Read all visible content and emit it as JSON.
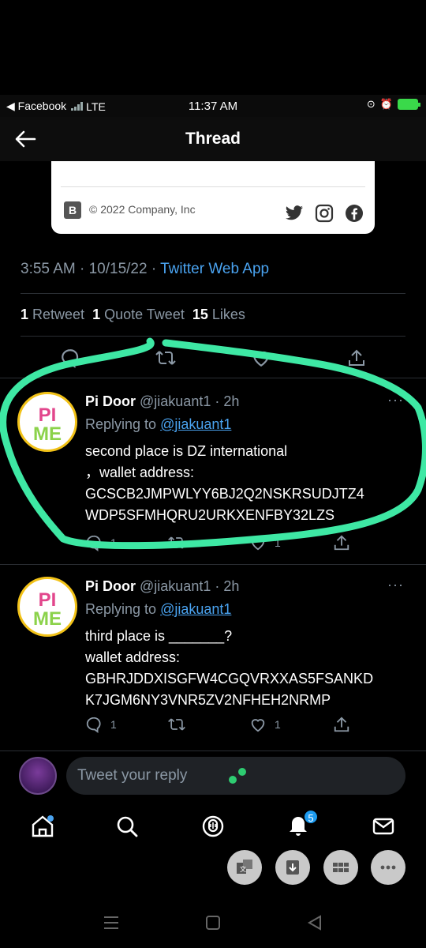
{
  "status_bar": {
    "back_app": "◀ Facebook",
    "network": "LTE",
    "time": "11:37 AM"
  },
  "header": {
    "title": "Thread"
  },
  "card": {
    "badge": "B",
    "copyright": "© 2022 Company, Inc"
  },
  "tweet_meta": {
    "time_date": "3:55 AM · 10/15/22 · ",
    "source": "Twitter Web App"
  },
  "stats": {
    "retweets_count": "1",
    "retweets_label": " Retweet",
    "quotes_count": "1",
    "quotes_label": " Quote Tweet",
    "likes_count": "15",
    "likes_label": " Likes"
  },
  "replies": [
    {
      "name": "Pi Door",
      "handle": " @jiakuant1 · 2h",
      "replying_prefix": "Replying to ",
      "replying_to": "@jiakuant1",
      "line1": "second place is DZ international",
      "line2": "，wallet address:",
      "line3": "GCSCB2JMPWLYY6BJ2Q2NSKRSUDJTZ4",
      "line4": "WDP5SFMHQRU2URKXENFBY32LZS",
      "reply_count": "1",
      "like_count": "1"
    },
    {
      "name": "Pi Door",
      "handle": " @jiakuant1 · 2h",
      "replying_prefix": "Replying to ",
      "replying_to": "@jiakuant1",
      "line1": "third place is _______?",
      "line2": "wallet address:",
      "line3": "GBHRJDDXISGFW4CGQVRXXAS5FSANKD",
      "line4": "K7JGM6NY3VNR5ZV2NFHEH2NRMP",
      "reply_count": "1",
      "like_count": "1"
    }
  ],
  "reply_box": {
    "placeholder": "Tweet your reply"
  },
  "bottom_nav": {
    "notifications_badge": "5"
  },
  "avatar_text": {
    "top": "PI",
    "bottom": "ME"
  },
  "colors": {
    "highlight": "#3ee8a4",
    "link": "#4aa3f0",
    "muted": "#8b98a5"
  }
}
